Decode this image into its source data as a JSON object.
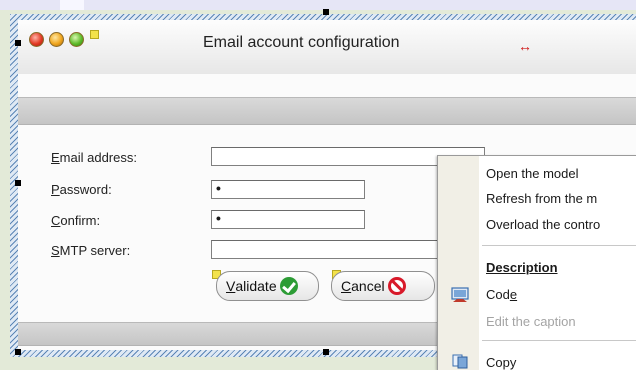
{
  "window": {
    "title": "Email account configuration",
    "title_arrow_glyph": "↔"
  },
  "form": {
    "fields": [
      {
        "label": "Email address:",
        "mnemonic": "E",
        "rest": "mail address:",
        "value": ""
      },
      {
        "label": "Password:",
        "mnemonic": "P",
        "rest": "assword:",
        "value": "•"
      },
      {
        "label": "Confirm:",
        "mnemonic": "C",
        "rest": "onfirm:",
        "value": "•"
      },
      {
        "label": "SMTP server:",
        "mnemonic": "S",
        "rest": "MTP server:",
        "value": ""
      }
    ],
    "validate_label": "Validate",
    "validate_mnemonic": "V",
    "validate_rest": "alidate",
    "cancel_label": "Cancel",
    "cancel_mnemonic": "C",
    "cancel_rest": "ancel"
  },
  "context_menu": {
    "items": [
      {
        "label": "Open the model",
        "style": "normal"
      },
      {
        "label": "Refresh from the m",
        "style": "normal"
      },
      {
        "label": "Overload the contro",
        "style": "normal"
      },
      {
        "label": "Description",
        "style": "bold"
      },
      {
        "label": "Code",
        "style": "normal",
        "pre": "Cod",
        "mnemonic": "e"
      },
      {
        "label": "Edit the caption",
        "style": "disabled"
      },
      {
        "label": "Copy",
        "style": "normal"
      }
    ]
  },
  "colors": {
    "background": "#e3ead8",
    "hatch": "#5c86b6",
    "title_arrow": "#d01818",
    "validate_icon": "#2c9c35",
    "cancel_icon": "#d8192a"
  }
}
